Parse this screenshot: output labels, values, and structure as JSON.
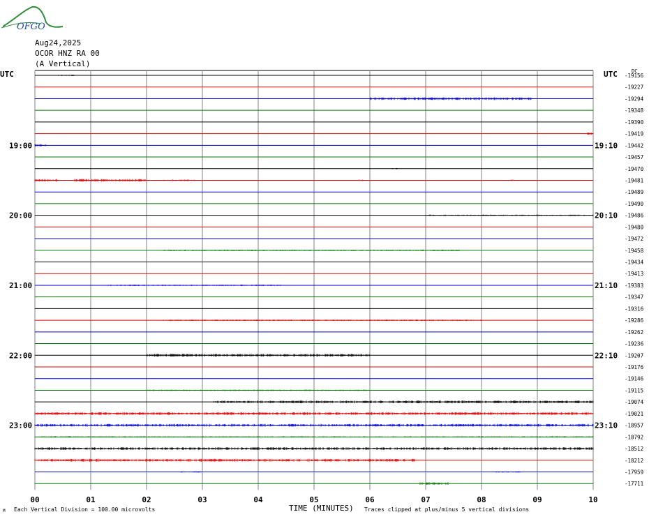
{
  "header": {
    "date": "Aug24,2025",
    "station": "OCOR HNZ RA 00",
    "component": "(A Vertical)",
    "logo_text": "OFGO"
  },
  "labels": {
    "utc_left": "UTC",
    "utc_right": "UTC",
    "dc_label": "DC",
    "left_hours": [
      "19:00",
      "20:00",
      "21:00",
      "22:00",
      "23:00"
    ],
    "right_hours": [
      "19:10",
      "20:10",
      "21:10",
      "22:10",
      "23:10"
    ]
  },
  "footer": {
    "xlabel": "TIME (MINUTES)",
    "scale_note": "Each Vertical Division =  100.00 microvolts",
    "clip_note": "Traces clipped at plus/minus 5 vertical divisions",
    "corner_mark": "M"
  },
  "colors": {
    "trace_cycle": [
      "#000000",
      "#dd0000",
      "#0000cc",
      "#007700"
    ],
    "grid": "#808080"
  },
  "chart_data": {
    "type": "line",
    "title": "OCOR HNZ RA 00",
    "xlabel": "TIME (MINUTES)",
    "ylabel": "",
    "xlim": [
      0,
      10
    ],
    "x_ticks": [
      "00",
      "01",
      "02",
      "03",
      "04",
      "05",
      "06",
      "07",
      "08",
      "09",
      "10"
    ],
    "trace_minutes": 10,
    "dc_offsets": [
      "-19156",
      "-19227",
      "-19294",
      "-19348",
      "-19390",
      "-19419",
      "-19442",
      "-19457",
      "-19470",
      "-19481",
      "-19489",
      "-19490",
      "-19486",
      "-19480",
      "-19472",
      "-19458",
      "-19434",
      "-19413",
      "-19383",
      "-19347",
      "-19316",
      "-19286",
      "-19262",
      "-19236",
      "-19207",
      "-19176",
      "-19146",
      "-19115",
      "-19074",
      "-19021",
      "-18957",
      "-18792",
      "-18512",
      "-18212",
      "-17959",
      "-17711"
    ],
    "noise_bursts": [
      {
        "trace": 0,
        "start": 0.4,
        "end": 0.7,
        "amp": 1
      },
      {
        "trace": 2,
        "start": 6.0,
        "end": 8.9,
        "amp": 2
      },
      {
        "trace": 5,
        "start": 9.9,
        "end": 10.0,
        "amp": 2
      },
      {
        "trace": 6,
        "start": 0.0,
        "end": 0.2,
        "amp": 2
      },
      {
        "trace": 8,
        "start": 6.4,
        "end": 6.5,
        "amp": 1
      },
      {
        "trace": 9,
        "start": 0.0,
        "end": 0.4,
        "amp": 2
      },
      {
        "trace": 9,
        "start": 0.7,
        "end": 2.0,
        "amp": 2
      },
      {
        "trace": 9,
        "start": 2.3,
        "end": 2.9,
        "amp": 1
      },
      {
        "trace": 9,
        "start": 5.8,
        "end": 5.9,
        "amp": 1
      },
      {
        "trace": 9,
        "start": 8.5,
        "end": 8.6,
        "amp": 1
      },
      {
        "trace": 12,
        "start": 7.0,
        "end": 10.0,
        "amp": 1
      },
      {
        "trace": 15,
        "start": 2.3,
        "end": 7.6,
        "amp": 1
      },
      {
        "trace": 18,
        "start": 1.3,
        "end": 4.4,
        "amp": 1
      },
      {
        "trace": 21,
        "start": 2.3,
        "end": 8.0,
        "amp": 1
      },
      {
        "trace": 24,
        "start": 2.0,
        "end": 6.0,
        "amp": 2
      },
      {
        "trace": 27,
        "start": 2.0,
        "end": 6.0,
        "amp": 1
      },
      {
        "trace": 28,
        "start": 3.2,
        "end": 10.0,
        "amp": 2
      },
      {
        "trace": 29,
        "start": 0.0,
        "end": 10.0,
        "amp": 2
      },
      {
        "trace": 30,
        "start": 0.0,
        "end": 10.0,
        "amp": 2
      },
      {
        "trace": 31,
        "start": 0.0,
        "end": 10.0,
        "amp": 1
      },
      {
        "trace": 32,
        "start": 0.0,
        "end": 10.0,
        "amp": 2
      },
      {
        "trace": 33,
        "start": 0.0,
        "end": 6.8,
        "amp": 2
      },
      {
        "trace": 34,
        "start": 2.6,
        "end": 3.0,
        "amp": 1
      },
      {
        "trace": 34,
        "start": 8.2,
        "end": 8.7,
        "amp": 1
      },
      {
        "trace": 35,
        "start": 6.9,
        "end": 7.4,
        "amp": 2
      }
    ],
    "grid": true
  }
}
